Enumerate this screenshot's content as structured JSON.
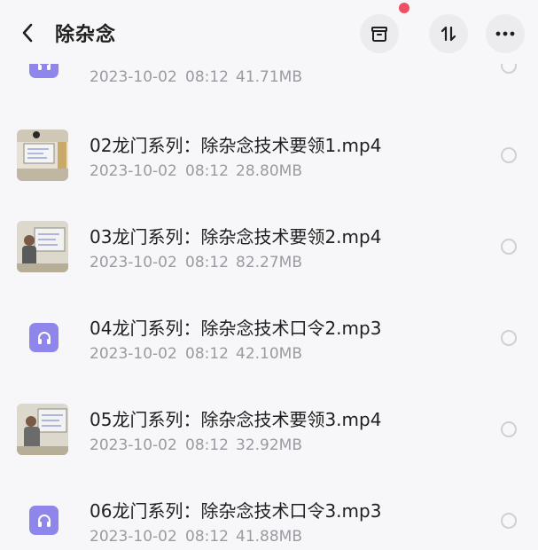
{
  "header": {
    "title": "除杂念",
    "back_icon": "chevron-left-icon",
    "archive_icon": "archive-box-icon",
    "sort_icon": "sort-arrows-icon",
    "more_icon": "more-dots-icon",
    "notification_dot_color": "#ef4f62"
  },
  "files": [
    {
      "name": "",
      "date": "2023-10-02",
      "time": "08:12",
      "size": "41.71MB",
      "type": "audio"
    },
    {
      "name": "02龙门系列：除杂念技术要领1.mp4",
      "date": "2023-10-02",
      "time": "08:12",
      "size": "28.80MB",
      "type": "video"
    },
    {
      "name": "03龙门系列：除杂念技术要领2.mp4",
      "date": "2023-10-02",
      "time": "08:12",
      "size": "82.27MB",
      "type": "video"
    },
    {
      "name": "04龙门系列：除杂念技术口令2.mp3",
      "date": "2023-10-02",
      "time": "08:12",
      "size": "42.10MB",
      "type": "audio"
    },
    {
      "name": "05龙门系列：除杂念技术要领3.mp4",
      "date": "2023-10-02",
      "time": "08:12",
      "size": "32.92MB",
      "type": "video"
    },
    {
      "name": "06龙门系列：除杂念技术口令3.mp3",
      "date": "2023-10-02",
      "time": "08:12",
      "size": "41.88MB",
      "type": "audio"
    }
  ],
  "colors": {
    "audio_icon": "#8e86ea",
    "meta_text": "#9a9aa2",
    "radio_border": "#cfcfd4"
  }
}
